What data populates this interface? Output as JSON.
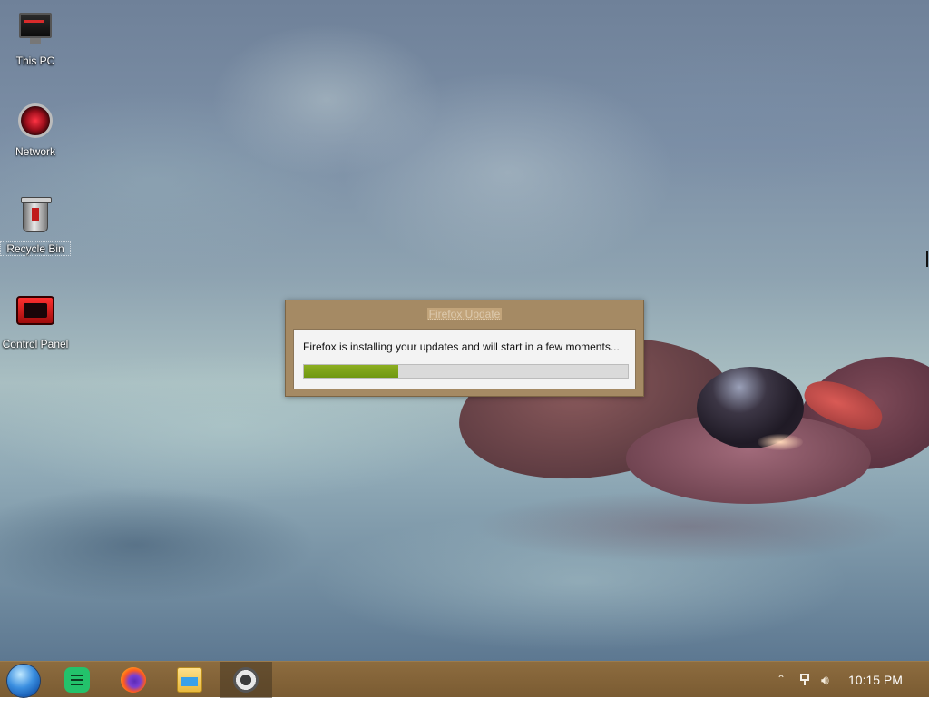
{
  "desktop": {
    "icons": [
      {
        "label": "This PC",
        "icon": "computer-icon"
      },
      {
        "label": "Network",
        "icon": "network-icon"
      },
      {
        "label": "Recycle Bin",
        "icon": "recycle-bin-icon"
      },
      {
        "label": "Control Panel",
        "icon": "control-panel-icon"
      }
    ]
  },
  "dialog": {
    "title": "Firefox Update",
    "message": "Firefox is installing your updates and will start in a few moments...",
    "progress": 0.29
  },
  "taskbar": {
    "apps": [
      {
        "name": "start-orb"
      },
      {
        "name": "notes-app-icon"
      },
      {
        "name": "firefox-icon"
      },
      {
        "name": "file-explorer-icon"
      },
      {
        "name": "firefox-updater-icon"
      }
    ],
    "clock": "10:15 PM"
  },
  "colors": {
    "dialog_frame": "#a58a64",
    "progress_fill": "#7ea31a",
    "taskbar": "#84633a"
  }
}
